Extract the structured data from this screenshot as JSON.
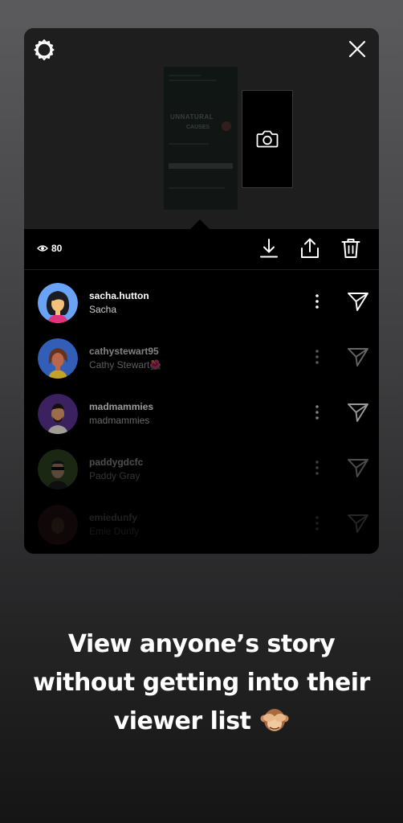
{
  "story": {
    "preview_text_1": "UNNATURAL",
    "preview_text_2": "CAUSES"
  },
  "toolbar": {
    "view_count": "80",
    "icons": [
      "eye-icon",
      "download-icon",
      "share-icon",
      "trash-icon"
    ]
  },
  "viewers": [
    {
      "username": "sacha.hutton",
      "name": "Sacha",
      "opacity": 1.0
    },
    {
      "username": "cathystewart95",
      "name": "Cathy Stewart🌺",
      "opacity": 0.5
    },
    {
      "username": "madmammies",
      "name": "madmammies",
      "opacity": 0.6
    },
    {
      "username": "paddygdcfc",
      "name": "Paddy Gray",
      "opacity": 0.3
    },
    {
      "username": "emiedunfy",
      "name": "Emie Dunfy",
      "opacity": 0.12
    }
  ],
  "headline": {
    "line1": "View anyone’s story",
    "line2": "without getting into their",
    "line3": "viewer list"
  },
  "colors": {
    "card_bg": "#000000",
    "top_bg": "#1e1e1f",
    "text": "#ffffff"
  }
}
